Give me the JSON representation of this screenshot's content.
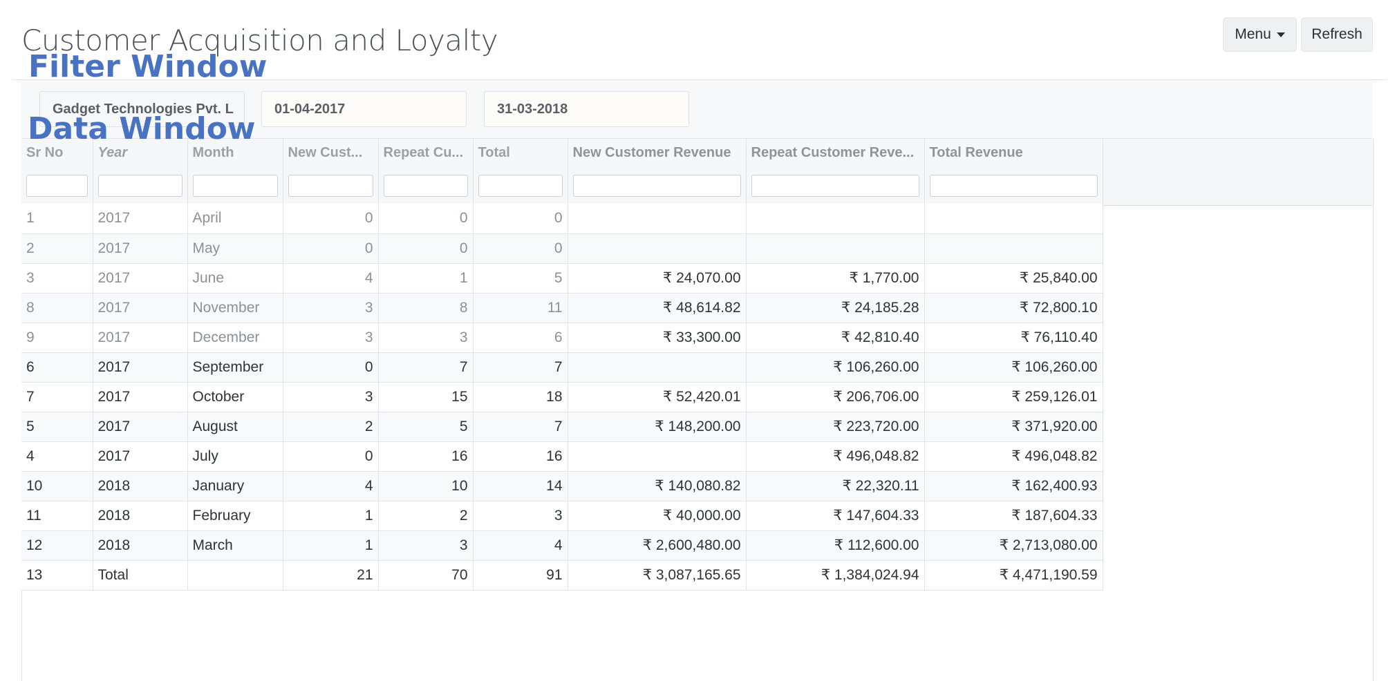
{
  "page": {
    "title": "Customer Acquisition and Loyalty"
  },
  "toolbar": {
    "menu_label": "Menu",
    "refresh_label": "Refresh"
  },
  "overlays": {
    "filter_window": "Filter Window",
    "data_window": "Data Window"
  },
  "filters": {
    "company": "Gadget Technologies Pvt. L",
    "from_date": "01-04-2017",
    "to_date": "31-03-2018"
  },
  "grid": {
    "columns": [
      "Sr No",
      "Year",
      "Month",
      "New Cust...",
      "Repeat Cu...",
      "Total",
      "New Customer Revenue",
      "Repeat Customer Reve...",
      "Total Revenue"
    ],
    "rows": [
      {
        "sr": "1",
        "year": "2017",
        "month": "April",
        "new": "0",
        "repeat": "0",
        "total": "0",
        "new_rev": "",
        "repeat_rev": "",
        "total_rev": ""
      },
      {
        "sr": "2",
        "year": "2017",
        "month": "May",
        "new": "0",
        "repeat": "0",
        "total": "0",
        "new_rev": "",
        "repeat_rev": "",
        "total_rev": ""
      },
      {
        "sr": "3",
        "year": "2017",
        "month": "June",
        "new": "4",
        "repeat": "1",
        "total": "5",
        "new_rev": "₹ 24,070.00",
        "repeat_rev": "₹ 1,770.00",
        "total_rev": "₹ 25,840.00"
      },
      {
        "sr": "8",
        "year": "2017",
        "month": "November",
        "new": "3",
        "repeat": "8",
        "total": "11",
        "new_rev": "₹ 48,614.82",
        "repeat_rev": "₹ 24,185.28",
        "total_rev": "₹ 72,800.10"
      },
      {
        "sr": "9",
        "year": "2017",
        "month": "December",
        "new": "3",
        "repeat": "3",
        "total": "6",
        "new_rev": "₹ 33,300.00",
        "repeat_rev": "₹ 42,810.40",
        "total_rev": "₹ 76,110.40"
      },
      {
        "sr": "6",
        "year": "2017",
        "month": "September",
        "new": "0",
        "repeat": "7",
        "total": "7",
        "new_rev": "",
        "repeat_rev": "₹ 106,260.00",
        "total_rev": "₹ 106,260.00"
      },
      {
        "sr": "7",
        "year": "2017",
        "month": "October",
        "new": "3",
        "repeat": "15",
        "total": "18",
        "new_rev": "₹ 52,420.01",
        "repeat_rev": "₹ 206,706.00",
        "total_rev": "₹ 259,126.01"
      },
      {
        "sr": "5",
        "year": "2017",
        "month": "August",
        "new": "2",
        "repeat": "5",
        "total": "7",
        "new_rev": "₹ 148,200.00",
        "repeat_rev": "₹ 223,720.00",
        "total_rev": "₹ 371,920.00"
      },
      {
        "sr": "4",
        "year": "2017",
        "month": "July",
        "new": "0",
        "repeat": "16",
        "total": "16",
        "new_rev": "",
        "repeat_rev": "₹ 496,048.82",
        "total_rev": "₹ 496,048.82"
      },
      {
        "sr": "10",
        "year": "2018",
        "month": "January",
        "new": "4",
        "repeat": "10",
        "total": "14",
        "new_rev": "₹ 140,080.82",
        "repeat_rev": "₹ 22,320.11",
        "total_rev": "₹ 162,400.93"
      },
      {
        "sr": "11",
        "year": "2018",
        "month": "February",
        "new": "1",
        "repeat": "2",
        "total": "3",
        "new_rev": "₹ 40,000.00",
        "repeat_rev": "₹ 147,604.33",
        "total_rev": "₹ 187,604.33"
      },
      {
        "sr": "12",
        "year": "2018",
        "month": "March",
        "new": "1",
        "repeat": "3",
        "total": "4",
        "new_rev": "₹ 2,600,480.00",
        "repeat_rev": "₹ 112,600.00",
        "total_rev": "₹ 2,713,080.00"
      },
      {
        "sr": "13",
        "year": "Total",
        "month": "",
        "new": "21",
        "repeat": "70",
        "total": "91",
        "new_rev": "₹ 3,087,165.65",
        "repeat_rev": "₹ 1,384,024.94",
        "total_rev": "₹ 4,471,190.59"
      }
    ]
  }
}
